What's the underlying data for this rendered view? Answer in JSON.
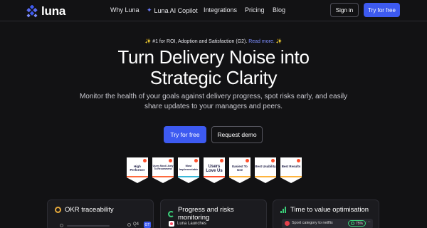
{
  "brand": {
    "name": "luna",
    "accent": "#3d5af1"
  },
  "nav": {
    "links": [
      "Why Luna",
      "Luna AI Copilot",
      "Integrations",
      "Pricing",
      "Blog"
    ],
    "signin_label": "Sign in",
    "try_label": "Try for free"
  },
  "hero": {
    "eyebrow_text": "#1 for ROI, Adoption and Satisfaction (G2).",
    "eyebrow_link": "Read more.",
    "headline_line1": "Turn Delivery Noise into",
    "headline_line2": "Strategic Clarity",
    "subtitle": "Monitor the health of your goals against delivery progress, spot risks early, and easily share updates to your managers and peers.",
    "primary_cta": "Try for free",
    "secondary_cta": "Request demo"
  },
  "badges": [
    {
      "label": "High Performer",
      "stripe": "#ff6a3d"
    },
    {
      "label": "Users Most Likely To Recommend",
      "stripe": "#ff6a3d"
    },
    {
      "label": "Most Implementable",
      "stripe": "#3bb7d8"
    },
    {
      "label": "Users Love Us",
      "stripe": "#ff4f2b"
    },
    {
      "label": "Easiest To Use",
      "stripe": "#ffb43d"
    },
    {
      "label": "Best Usability",
      "stripe": "#ffb43d"
    },
    {
      "label": "Best Results",
      "stripe": "#ffb43d"
    }
  ],
  "cards": {
    "okr": {
      "title": "OKR traceability",
      "quarter": "Q4",
      "avatar": "GT"
    },
    "progress": {
      "title": "Progress and risks monitoring",
      "item": "Luna Launches"
    },
    "time": {
      "title": "Time to value optimisation",
      "item": "Sport category to netflix",
      "percent": "75%",
      "more": "···"
    }
  }
}
